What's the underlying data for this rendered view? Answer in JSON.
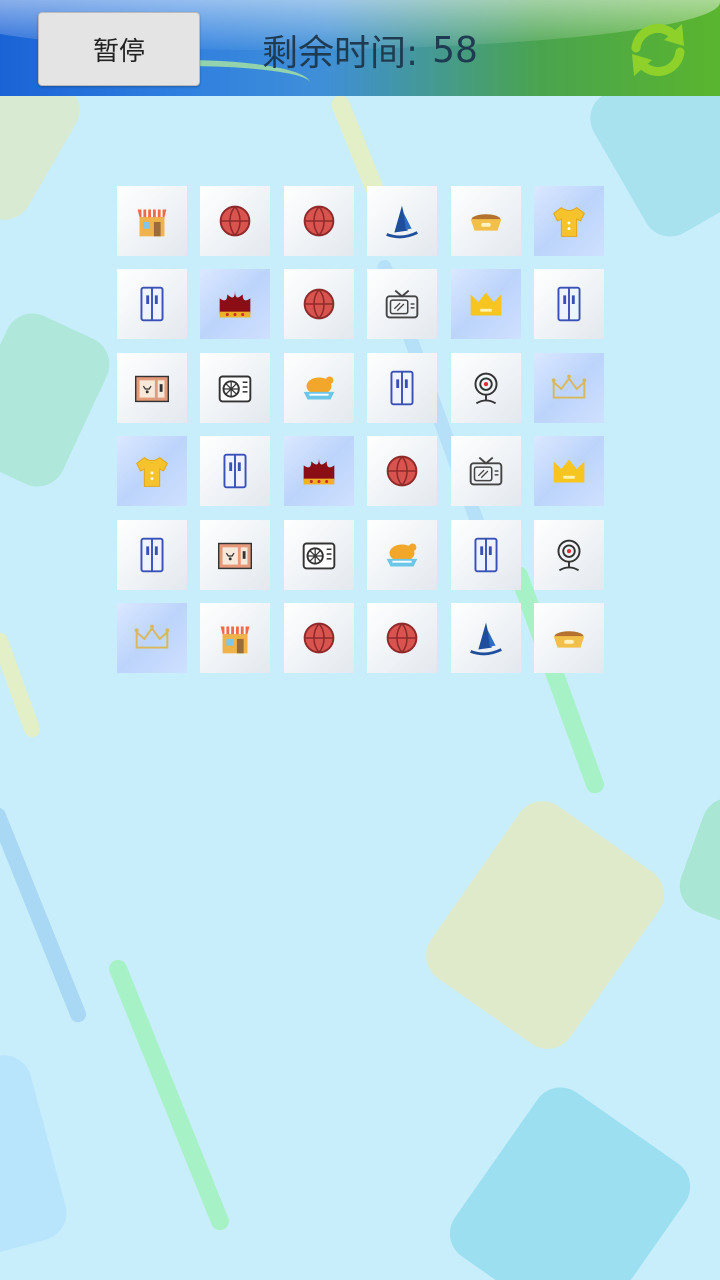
{
  "header": {
    "pause_label": "暂停",
    "timer_label": "剩余时间:",
    "timer_value": "58"
  },
  "colors": {
    "header_left": "#1a63d6",
    "header_right": "#5ab52e",
    "background": "#c9eefb",
    "refresh_icon": "#8fd12b"
  },
  "board": {
    "rows": 6,
    "cols": 6,
    "tiles": [
      [
        "shop-icon",
        "ball-icon",
        "ball-icon",
        "sailboat-icon",
        "pet-bowl-icon",
        "shirt-icon"
      ],
      [
        "fridge-icon",
        "crown-red-icon",
        "ball-icon",
        "tv-icon",
        "crown-gold-icon",
        "fridge-icon"
      ],
      [
        "socket-icon",
        "air-conditioner-icon",
        "roast-chicken-icon",
        "fridge-icon",
        "webcam-icon",
        "crown-outline-icon"
      ],
      [
        "shirt-icon",
        "fridge-icon",
        "crown-red-icon",
        "ball-icon",
        "tv-icon",
        "crown-gold-icon"
      ],
      [
        "fridge-icon",
        "socket-icon",
        "air-conditioner-icon",
        "roast-chicken-icon",
        "fridge-icon",
        "webcam-icon"
      ],
      [
        "crown-outline-icon",
        "shop-icon",
        "ball-icon",
        "ball-icon",
        "sailboat-icon",
        "pet-bowl-icon"
      ]
    ]
  }
}
